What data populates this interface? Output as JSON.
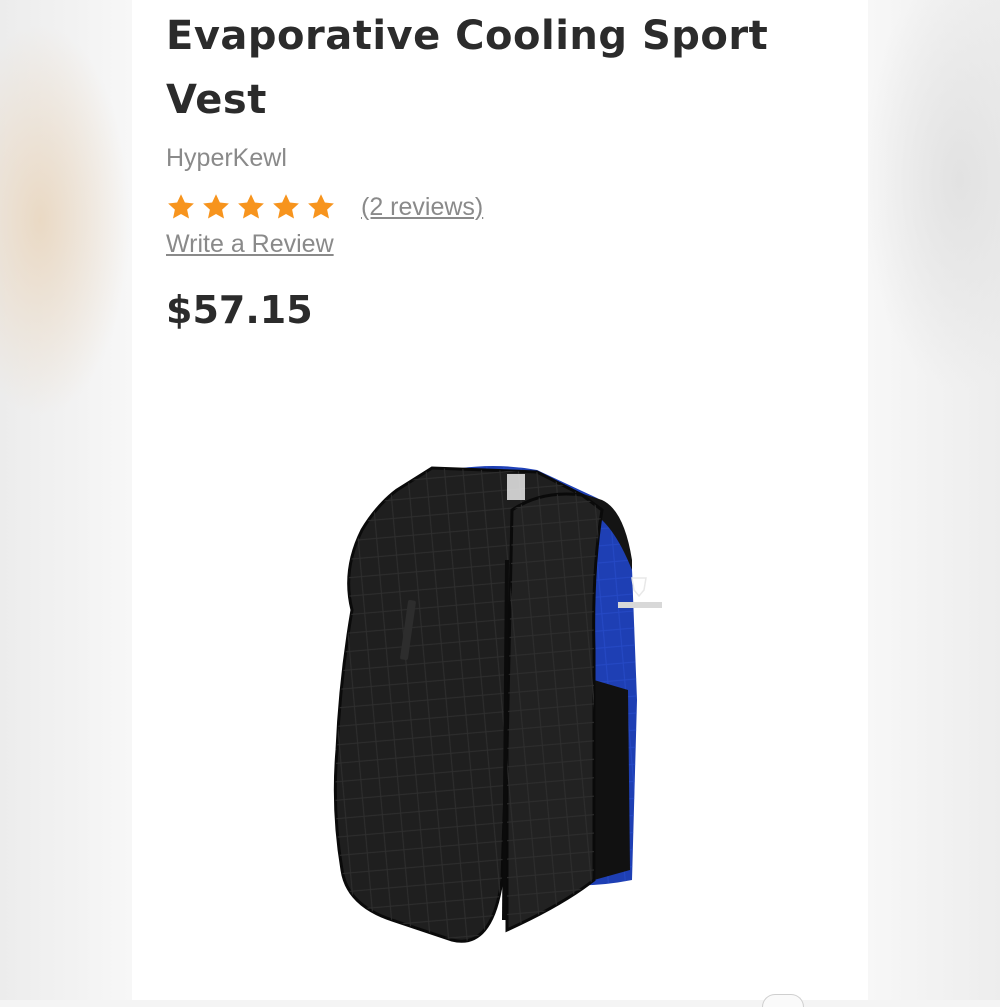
{
  "product": {
    "title": "Evaporative Cooling Sport Vest",
    "brand": "HyperKewl",
    "rating": {
      "stars": 5,
      "max_stars": 5,
      "star_color": "#F7941D",
      "reviews_link": "(2 reviews)",
      "write_review": "Write a Review"
    },
    "price": "$57.15",
    "image": {
      "icon": "vest-image",
      "colors": {
        "shell": "#1f1f1f",
        "lining": "#1e3fb4",
        "trim": "#0d0d0d"
      }
    }
  }
}
